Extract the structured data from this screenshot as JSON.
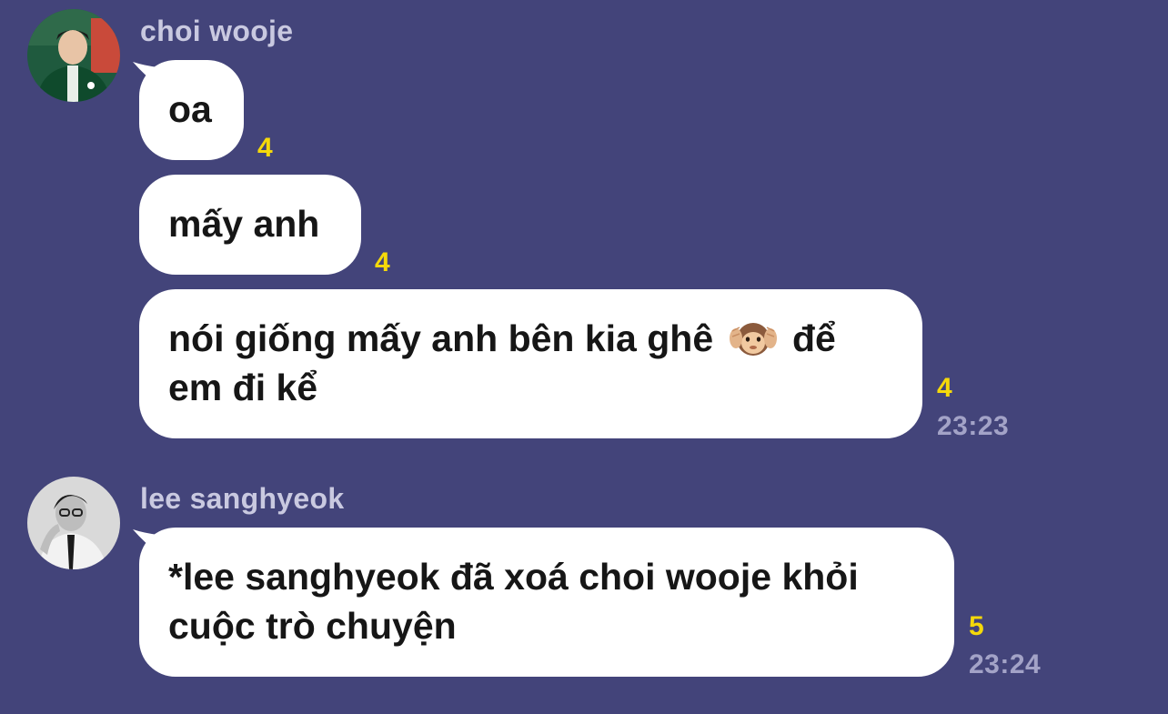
{
  "groups": [
    {
      "sender": "choi wooje",
      "avatar_icon": "profile-photo-green-jacket",
      "messages": [
        {
          "text": "oa",
          "unread": "4"
        },
        {
          "text": "mấy anh",
          "unread": "4"
        },
        {
          "text_before": "nói giống mấy anh bên kia ghê",
          "emoji": "hear-no-evil-monkey",
          "text_after": "để em đi kể",
          "line1": "nói giống mấy anh bên kia ghê",
          "line1_end": "để",
          "line2": "em đi kể",
          "unread": "4",
          "time": "23:23"
        }
      ]
    },
    {
      "sender": "lee sanghyeok",
      "avatar_icon": "profile-photo-black-white-suit",
      "messages": [
        {
          "line1": "*lee sanghyeok đã xoá choi wooje khỏi",
          "line2": "cuộc trò chuyện",
          "unread": "5",
          "time": "23:24"
        }
      ]
    }
  ],
  "colors": {
    "background": "#43447a",
    "bubble": "#ffffff",
    "unread": "#f5d90a",
    "time": "#a3a3c7",
    "sender": "#c9c9e0"
  }
}
